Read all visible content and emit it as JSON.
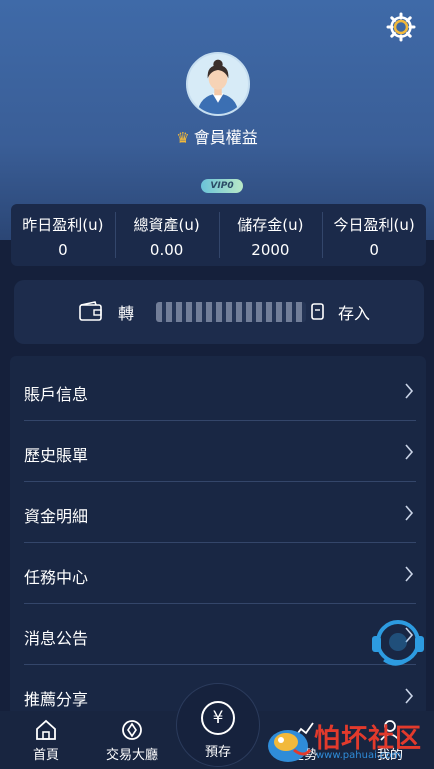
{
  "profile": {
    "title": "會員權益",
    "vip_label": "VIP0"
  },
  "stats": [
    {
      "label": "昨日盈利(u)",
      "value": "0"
    },
    {
      "label": "總資產(u)",
      "value": "0.00"
    },
    {
      "label": "儲存金(u)",
      "value": "2000"
    },
    {
      "label": "今日盈利(u)",
      "value": "0"
    }
  ],
  "transfer": {
    "left_label": "轉",
    "right_label": "存入"
  },
  "menu": [
    {
      "label": "賬戶信息"
    },
    {
      "label": "歷史賬單"
    },
    {
      "label": "資金明細"
    },
    {
      "label": "任務中心"
    },
    {
      "label": "消息公告"
    },
    {
      "label": "推薦分享"
    }
  ],
  "tabs": [
    {
      "label": "首頁"
    },
    {
      "label": "交易大廳"
    },
    {
      "label": "預存"
    },
    {
      "label": "走勢"
    },
    {
      "label": "我的"
    }
  ],
  "watermark": {
    "text": "怕坏社区",
    "url": "www.pahuai.com"
  },
  "icons": {
    "settings": "gear-icon",
    "wallet": "wallet-icon",
    "deposit": "deposit-icon",
    "chevron": "chevron-right-icon",
    "support": "headset-icon",
    "home": "home-icon",
    "trade": "compass-icon",
    "yen": "yen-icon"
  },
  "colors": {
    "header": "#3f6aa8",
    "background": "#15203b",
    "card": "#192744",
    "gold": "#f2b93b"
  }
}
